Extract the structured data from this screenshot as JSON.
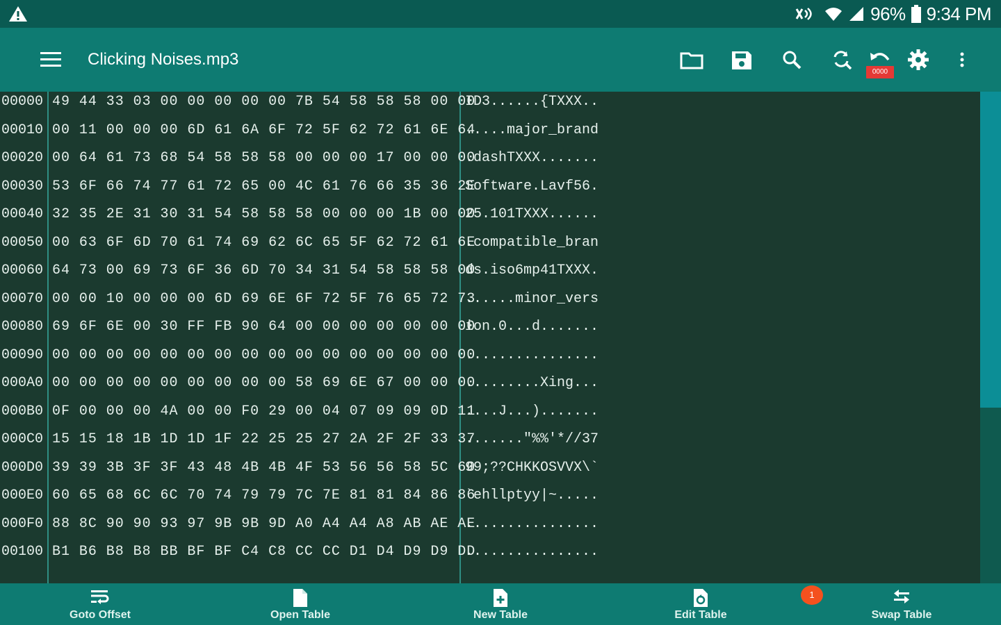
{
  "status_bar": {
    "battery": "96%",
    "time": "9:34 PM"
  },
  "app_bar": {
    "title": "Clicking Noises.mp3",
    "undo_badge": "0000"
  },
  "hex_view": {
    "rows": [
      {
        "offset": "00000",
        "hex": "49 44 33 03 00 00 00 00 00 7B 54 58 58 58 00 00",
        "ascii": "ID3......{TXXX.."
      },
      {
        "offset": "00010",
        "hex": "00 11 00 00 00 6D 61 6A 6F 72 5F 62 72 61 6E 64",
        "ascii": ".....major_brand"
      },
      {
        "offset": "00020",
        "hex": "00 64 61 73 68 54 58 58 58 00 00 00 17 00 00 00",
        "ascii": ".dashTXXX......."
      },
      {
        "offset": "00030",
        "hex": "53 6F 66 74 77 61 72 65 00 4C 61 76 66 35 36 2E",
        "ascii": "Software.Lavf56."
      },
      {
        "offset": "00040",
        "hex": "32 35 2E 31 30 31 54 58 58 58 00 00 00 1B 00 00",
        "ascii": "25.101TXXX......"
      },
      {
        "offset": "00050",
        "hex": "00 63 6F 6D 70 61 74 69 62 6C 65 5F 62 72 61 6E",
        "ascii": ".compatible_bran"
      },
      {
        "offset": "00060",
        "hex": "64 73 00 69 73 6F 36 6D 70 34 31 54 58 58 58 00",
        "ascii": "ds.iso6mp41TXXX."
      },
      {
        "offset": "00070",
        "hex": "00 00 10 00 00 00 6D 69 6E 6F 72 5F 76 65 72 73",
        "ascii": "......minor_vers"
      },
      {
        "offset": "00080",
        "hex": "69 6F 6E 00 30 FF FB 90 64 00 00 00 00 00 00 00",
        "ascii": "ion.0...d......."
      },
      {
        "offset": "00090",
        "hex": "00 00 00 00 00 00 00 00 00 00 00 00 00 00 00 00",
        "ascii": "................"
      },
      {
        "offset": "000A0",
        "hex": "00 00 00 00 00 00 00 00 00 58 69 6E 67 00 00 00",
        "ascii": ".........Xing..."
      },
      {
        "offset": "000B0",
        "hex": "0F 00 00 00 4A 00 00 F0 29 00 04 07 09 09 0D 11",
        "ascii": "....J...)......."
      },
      {
        "offset": "000C0",
        "hex": "15 15 18 1B 1D 1D 1F 22 25 25 27 2A 2F 2F 33 37",
        "ascii": ".......\"%%'*//37"
      },
      {
        "offset": "000D0",
        "hex": "39 39 3B 3F 3F 43 48 4B 4B 4F 53 56 56 58 5C 60",
        "ascii": "99;??CHKKOSVVX\\`"
      },
      {
        "offset": "000E0",
        "hex": "60 65 68 6C 6C 70 74 79 79 7C 7E 81 81 84 86 86",
        "ascii": "`ehllptyy|~....."
      },
      {
        "offset": "000F0",
        "hex": "88 8C 90 90 93 97 9B 9B 9D A0 A4 A4 A8 AB AE AE",
        "ascii": "................"
      },
      {
        "offset": "00100",
        "hex": "B1 B6 B8 B8 BB BF BF C4 C8 CC CC D1 D4 D9 D9 DD",
        "ascii": "................"
      }
    ]
  },
  "bottom_bar": {
    "items": [
      {
        "label": "Goto Offset",
        "icon": "goto-offset-icon"
      },
      {
        "label": "Open Table",
        "icon": "open-table-icon"
      },
      {
        "label": "New Table",
        "icon": "new-table-icon"
      },
      {
        "label": "Edit Table",
        "icon": "edit-table-icon"
      },
      {
        "label": "Swap Table",
        "icon": "swap-table-icon"
      }
    ],
    "notification_count": "1"
  },
  "colors": {
    "status_bar": "#0a5a52",
    "app_bar": "#0e7b72",
    "hex_background": "#1b3a2f",
    "scroll_thumb": "#0c8e96",
    "badge_red": "#e53935"
  }
}
